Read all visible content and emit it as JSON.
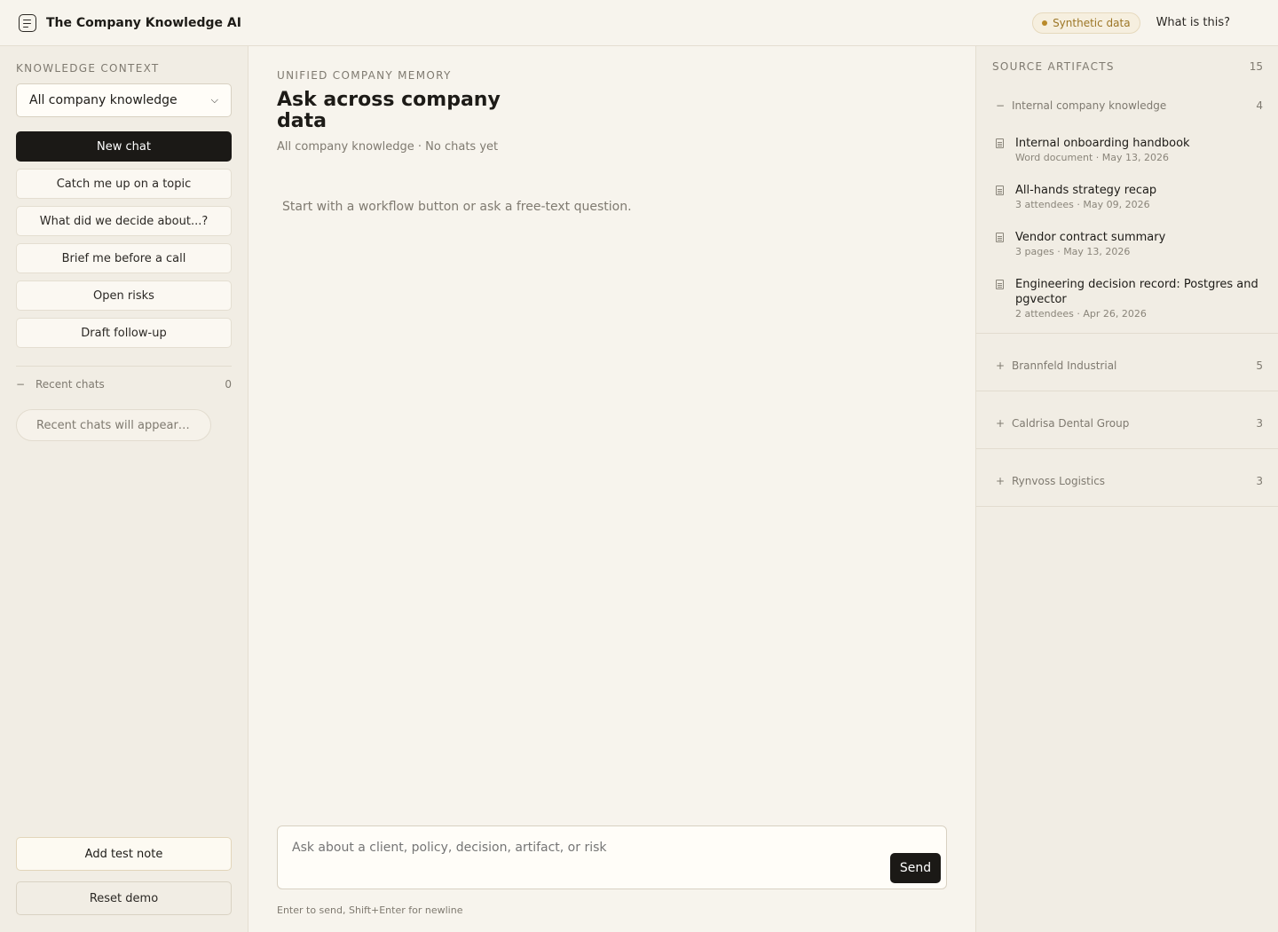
{
  "app": {
    "title": "The Company Knowledge AI",
    "badge": "Synthetic data",
    "help_link": "What is this?"
  },
  "sidebar": {
    "context_label": "KNOWLEDGE CONTEXT",
    "context_value": "All company knowledge",
    "new_chat": "New chat",
    "workflows": [
      "Catch me up on a topic",
      "What did we decide about...?",
      "Brief me before a call",
      "Open risks",
      "Draft follow-up"
    ],
    "recent": {
      "toggle": "−",
      "label": "Recent chats",
      "count": "0",
      "empty": "Recent chats will appear he..."
    },
    "add_note": "Add test note",
    "reset": "Reset demo"
  },
  "main": {
    "eyebrow": "UNIFIED COMPANY MEMORY",
    "title": "Ask across company data",
    "meta": "All company knowledge · No chats yet",
    "empty": "Start with a workflow button or ask a free-text question.",
    "composer_placeholder": "Ask about a client, policy, decision, artifact, or risk",
    "send": "Send",
    "hint": "Enter to send, Shift+Enter for newline"
  },
  "artifacts": {
    "label": "SOURCE ARTIFACTS",
    "count": "15",
    "groups": [
      {
        "toggle": "−",
        "name": "Internal company knowledge",
        "count": "4",
        "items": [
          {
            "icon": "document-icon",
            "title": "Internal onboarding handbook",
            "sub": "Word document · May 13, 2026"
          },
          {
            "icon": "meeting-notes-icon",
            "title": "All-hands strategy recap",
            "sub": "3 attendees · May 09, 2026"
          },
          {
            "icon": "document-icon",
            "title": "Vendor contract summary",
            "sub": "3 pages · May 13, 2026"
          },
          {
            "icon": "meeting-notes-icon",
            "title": "Engineering decision record: Postgres and pgvector",
            "sub": "2 attendees · Apr 26, 2026"
          }
        ]
      },
      {
        "toggle": "+",
        "name": "Brannfeld Industrial",
        "count": "5"
      },
      {
        "toggle": "+",
        "name": "Caldrisa Dental Group",
        "count": "3"
      },
      {
        "toggle": "+",
        "name": "Rynvoss Logistics",
        "count": "3"
      }
    ]
  }
}
